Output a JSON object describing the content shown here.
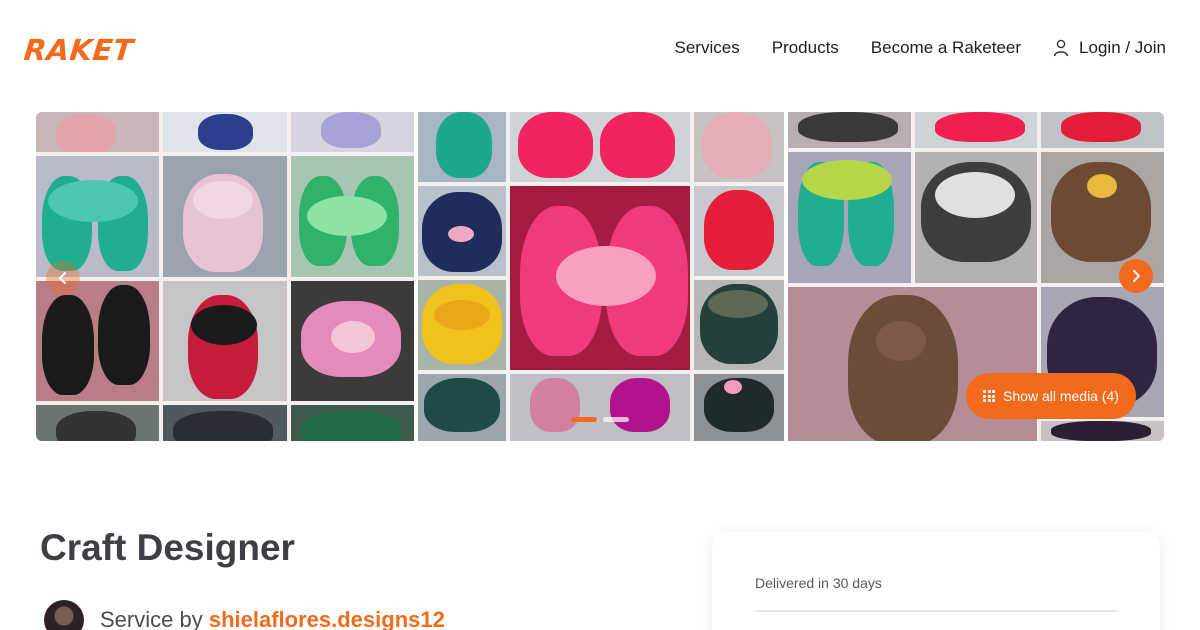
{
  "header": {
    "logo": "RAKET",
    "nav": [
      "Services",
      "Products",
      "Become a Raketeer"
    ],
    "login_label": "Login / Join"
  },
  "gallery": {
    "show_all_label": "Show all media (4)",
    "slide_count": 2,
    "active_slide": 1
  },
  "service": {
    "title": "Craft Designer",
    "service_by_prefix": "Service by",
    "seller": "shielaflores.designs12"
  },
  "card": {
    "delivered": "Delivered in 30 days"
  },
  "colors": {
    "accent": "#f26b1d",
    "title": "#3d3f44"
  },
  "icons": [
    "user-icon",
    "chevron-left-icon",
    "chevron-right-icon",
    "grid-icon"
  ]
}
